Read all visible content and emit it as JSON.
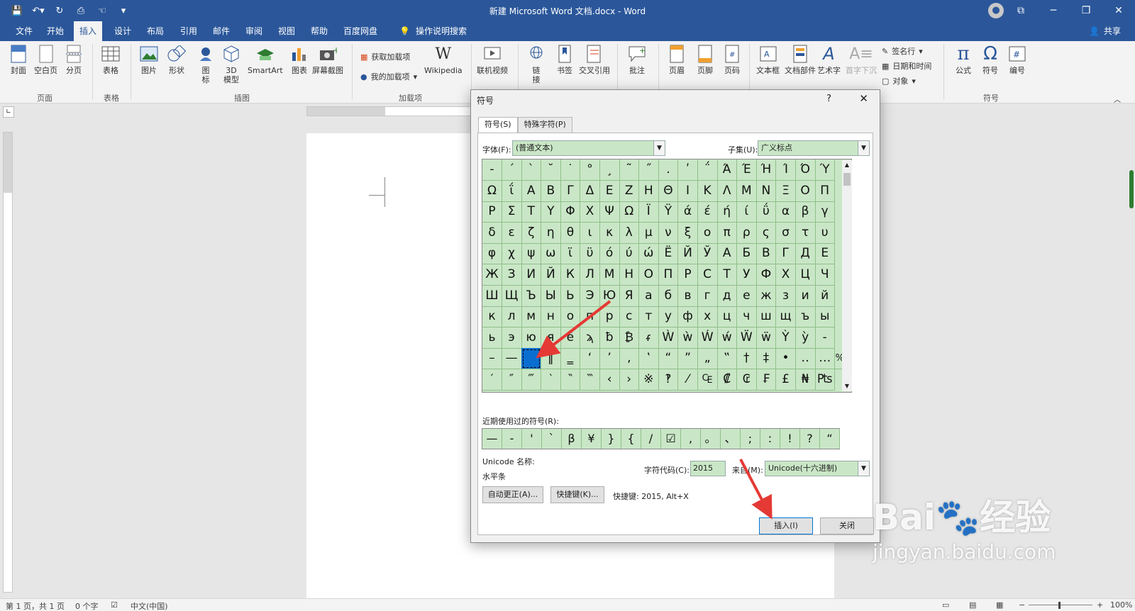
{
  "window": {
    "title": "新建 Microsoft Word 文档.docx - Word"
  },
  "menu_tabs": [
    "文件",
    "开始",
    "插入",
    "设计",
    "布局",
    "引用",
    "邮件",
    "审阅",
    "视图",
    "帮助",
    "百度网盘"
  ],
  "active_tab": "插入",
  "tell_me": "操作说明搜索",
  "share": "共享",
  "ribbon": {
    "pages": {
      "cover": "封面",
      "blank": "空白页",
      "break": "分页",
      "group": "页面"
    },
    "tables": {
      "table": "表格",
      "group": "表格"
    },
    "illustrations": {
      "picture": "图片",
      "shapes": "形状",
      "icons": "图\n标",
      "model3d": "3D\n模型",
      "smartart": "SmartArt",
      "chart": "图表",
      "screenshot": "屏幕截图",
      "group": "插图"
    },
    "addins": {
      "get": "获取加载项",
      "my": "我的加载项",
      "wikipedia": "Wikipedia",
      "group": "加载项"
    },
    "media": {
      "video": "联机视频"
    },
    "links": {
      "link": "链\n接",
      "bookmark": "书签",
      "crossref": "交叉引用"
    },
    "comments": {
      "comment": "批注"
    },
    "header_footer": {
      "header": "页眉",
      "footer": "页脚",
      "page_number": "页码"
    },
    "text": {
      "textbox": "文本框",
      "quickparts": "文档部件",
      "wordart": "艺术字",
      "dropcap": "首字下沉",
      "signature": "签名行",
      "datetime": "日期和时间",
      "object": "对象"
    },
    "symbols": {
      "equation": "公式",
      "symbol": "符号",
      "number": "编号",
      "group": "符号"
    }
  },
  "dialog": {
    "title": "符号",
    "help": "?",
    "tabs": [
      "符号(S)",
      "特殊字符(P)"
    ],
    "font_label": "字体(F):",
    "font_value": "(普通文本)",
    "subset_label": "子集(U):",
    "subset_value": "广义标点",
    "symbols": [
      [
        "‐",
        "´",
        "`",
        "˘",
        "˙",
        "°",
        "¸",
        "˜",
        "˝",
        ".",
        "ʹ",
        "΅",
        "Ά",
        "Έ",
        "Ή",
        "Ί",
        "Ό",
        "Ύ"
      ],
      [
        "Ω",
        "ΐ",
        "Α",
        "Β",
        "Γ",
        "Δ",
        "Ε",
        "Ζ",
        "Η",
        "Θ",
        "Ι",
        "Κ",
        "Λ",
        "Μ",
        "Ν",
        "Ξ",
        "Ο",
        "Π"
      ],
      [
        "Ρ",
        "Σ",
        "Τ",
        "Υ",
        "Φ",
        "Χ",
        "Ψ",
        "Ω",
        "Ϊ",
        "Ϋ",
        "ά",
        "έ",
        "ή",
        "ί",
        "ΰ",
        "α",
        "β",
        "γ"
      ],
      [
        "δ",
        "ε",
        "ζ",
        "η",
        "θ",
        "ι",
        "κ",
        "λ",
        "μ",
        "ν",
        "ξ",
        "ο",
        "π",
        "ρ",
        "ς",
        "σ",
        "τ",
        "υ"
      ],
      [
        "φ",
        "χ",
        "ψ",
        "ω",
        "ϊ",
        "ϋ",
        "ό",
        "ύ",
        "ώ",
        "Ё",
        "Й",
        "Ў",
        "А",
        "Б",
        "В",
        "Г",
        "Д",
        "Е"
      ],
      [
        "Ж",
        "З",
        "И",
        "Й",
        "К",
        "Л",
        "М",
        "Н",
        "О",
        "П",
        "Р",
        "С",
        "Т",
        "У",
        "Ф",
        "Х",
        "Ц",
        "Ч"
      ],
      [
        "Ш",
        "Щ",
        "Ъ",
        "Ы",
        "Ь",
        "Э",
        "Ю",
        "Я",
        "а",
        "б",
        "в",
        "г",
        "д",
        "е",
        "ж",
        "з",
        "и",
        "й"
      ],
      [
        "к",
        "л",
        "м",
        "н",
        "о",
        "п",
        "р",
        "с",
        "т",
        "у",
        "ф",
        "х",
        "ц",
        "ч",
        "ш",
        "щ",
        "ъ",
        "ы"
      ],
      [
        "ь",
        "э",
        "ю",
        "я",
        "ё",
        "ϡ",
        "ƀ",
        "₿",
        "ᵳ",
        "Ẁ",
        "ẁ",
        "Ẃ",
        "ẃ",
        "Ẅ",
        "ẅ",
        "Ỳ",
        "ỳ",
        "‐"
      ],
      [
        "–",
        "—",
        "―",
        "‖",
        "‗",
        "‘",
        "’",
        "‚",
        "‛",
        "“",
        "”",
        "„",
        "‟",
        "†",
        "‡",
        "•",
        "‥",
        "…"
      ],
      [
        "′",
        "″",
        "‴",
        "‵",
        "‶",
        "‷",
        "‹",
        "›",
        "※",
        "‽",
        "⁄",
        "₠",
        "₡",
        "₢",
        "₣",
        "£",
        "₦",
        "₧"
      ]
    ],
    "extra_col": [
      "",
      "",
      "",
      "",
      "",
      "",
      "",
      "",
      "",
      "‰",
      ""
    ],
    "selected_symbol": "―",
    "recent_label": "近期使用过的符号(R):",
    "recent": [
      "—",
      "-",
      "'",
      "`",
      "β",
      "¥",
      "}",
      "{",
      "/",
      "☑",
      ",",
      "。",
      "、",
      ";",
      ":",
      "!",
      "?",
      "“"
    ],
    "unicode_name_label": "Unicode 名称:",
    "unicode_name": "水平条",
    "charcode_label": "字符代码(C):",
    "charcode": "2015",
    "from_label": "来自(M):",
    "from_value": "Unicode(十六进制)",
    "autocorrect": "自动更正(A)...",
    "shortcut_key": "快捷键(K)...",
    "shortcut_text": "快捷键: 2015, Alt+X",
    "insert": "插入(I)",
    "close": "关闭"
  },
  "status": {
    "page": "第 1 页，共 1 页",
    "words": "0 个字",
    "language": "中文(中国)",
    "zoom": "100%"
  },
  "watermark": {
    "brand": "Bai",
    "brand_cn": "经验",
    "url": "jingyan.baidu.com"
  },
  "colors": {
    "word_blue": "#2b579a",
    "grid_green": "#c9e7c6",
    "selection": "#0a6ed1",
    "annotation_arrow": "#e53935"
  }
}
